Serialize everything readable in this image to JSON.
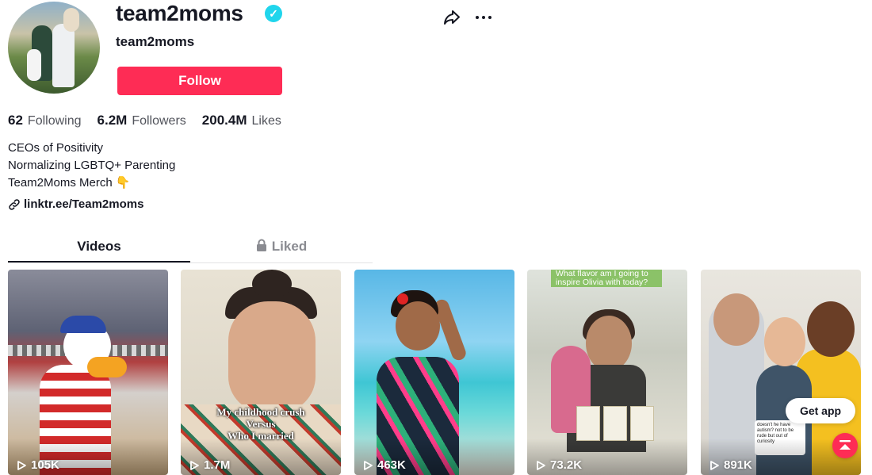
{
  "profile": {
    "username": "team2moms",
    "nickname": "team2moms",
    "verified": true,
    "follow_label": "Follow"
  },
  "stats": {
    "following_count": "62",
    "following_label": "Following",
    "followers_count": "6.2M",
    "followers_label": "Followers",
    "likes_count": "200.4M",
    "likes_label": "Likes"
  },
  "bio": {
    "line1": "CEOs of Positivity",
    "line2": "Normalizing LGBTQ+ Parenting",
    "line3": "Team2Moms Merch 👇",
    "link": "linktr.ee/Team2moms"
  },
  "tabs": [
    {
      "label": "Videos",
      "active": true
    },
    {
      "label": "Liked",
      "active": false,
      "locked": true
    }
  ],
  "videos": [
    {
      "views": "105K"
    },
    {
      "views": "1.7M",
      "caption_line1": "My childhood crush",
      "caption_line2": "Versus",
      "caption_line3": "Who I married"
    },
    {
      "views": "463K"
    },
    {
      "views": "73.2K",
      "banner": "What flavor am I going to inspire Olivia with today?"
    },
    {
      "views": "891K",
      "note": "doesn't he have autism? not to be rude but out of curiosity"
    }
  ],
  "floating": {
    "get_app_label": "Get app"
  },
  "icons": {
    "share": "share-icon",
    "more": "more-icon",
    "verified": "verified-icon",
    "link": "link-icon",
    "lock": "lock-icon",
    "play": "play-icon",
    "scroll_top": "scroll-top-icon"
  },
  "colors": {
    "accent": "#fe2c55",
    "verified": "#20d5ec",
    "text": "#161823",
    "muted": "#8a8b91"
  }
}
